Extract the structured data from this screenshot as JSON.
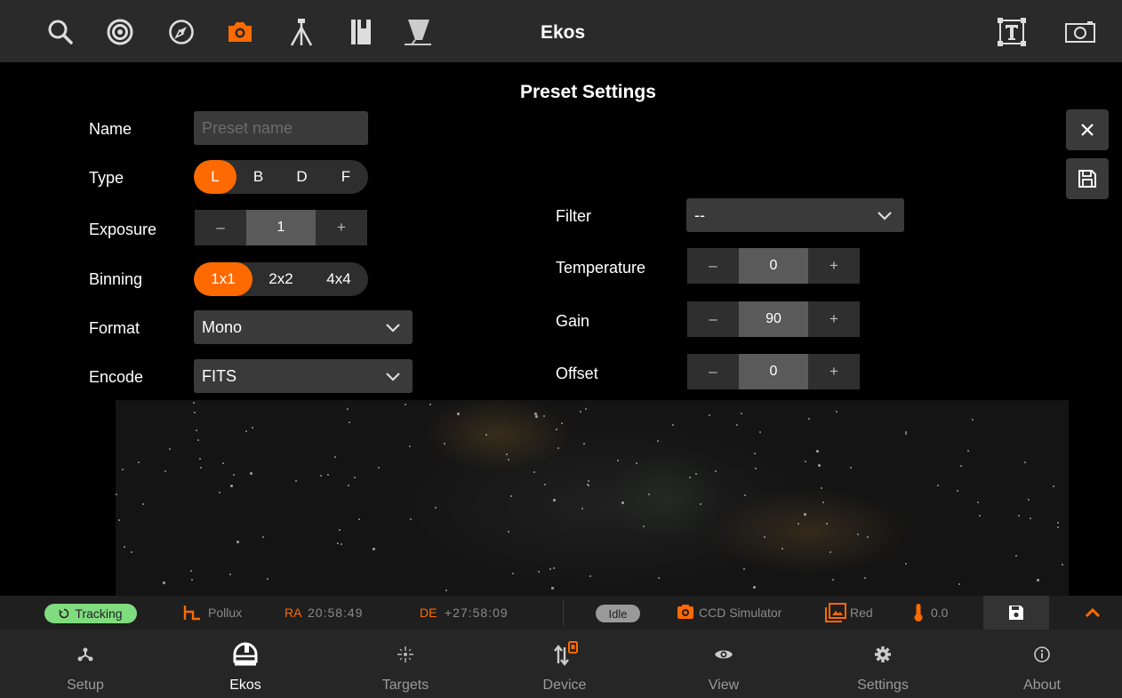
{
  "app": {
    "title": "Ekos"
  },
  "colors": {
    "accent": "#ff6a00",
    "tracking": "#7fdc7f",
    "ra_de_label": "#ff6a00"
  },
  "toolbar": {
    "icons": [
      "search-icon",
      "target-icon",
      "compass-icon",
      "camera-icon",
      "tripod-icon",
      "book-icon",
      "telescope-icon"
    ],
    "active_icon": "camera-icon",
    "right_icons": [
      "text-frame-icon",
      "screen-frame-icon"
    ]
  },
  "preset": {
    "title": "Preset Settings",
    "name": {
      "label": "Name",
      "placeholder": "Preset name",
      "value": ""
    },
    "type": {
      "label": "Type",
      "options": [
        "L",
        "B",
        "D",
        "F"
      ],
      "selected": "L"
    },
    "exposure": {
      "label": "Exposure",
      "value": "1",
      "minus": "–",
      "plus": "+"
    },
    "binning": {
      "label": "Binning",
      "options": [
        "1x1",
        "2x2",
        "4x4"
      ],
      "selected": "1x1"
    },
    "format": {
      "label": "Format",
      "value": "Mono"
    },
    "encode": {
      "label": "Encode",
      "value": "FITS"
    },
    "filter": {
      "label": "Filter",
      "value": "--"
    },
    "temperature": {
      "label": "Temperature",
      "value": "0",
      "minus": "–",
      "plus": "+"
    },
    "gain": {
      "label": "Gain",
      "value": "90",
      "minus": "–",
      "plus": "+"
    },
    "offset": {
      "label": "Offset",
      "value": "0",
      "minus": "–",
      "plus": "+"
    },
    "close_icon": "close-icon",
    "save_icon": "save-icon"
  },
  "status": {
    "tracking": "Tracking",
    "target": "Pollux",
    "ra_label": "RA",
    "ra_value": "20:58:49",
    "de_label": "DE",
    "de_value": "+27:58:09",
    "state": "Idle",
    "camera": "CCD Simulator",
    "filter": "Red",
    "temperature": "0.0"
  },
  "nav": {
    "items": [
      {
        "label": "Setup",
        "icon": "setup-icon"
      },
      {
        "label": "Ekos",
        "icon": "dome-icon"
      },
      {
        "label": "Targets",
        "icon": "targets-icon"
      },
      {
        "label": "Device",
        "icon": "device-icon"
      },
      {
        "label": "View",
        "icon": "eye-icon"
      },
      {
        "label": "Settings",
        "icon": "gear-icon"
      },
      {
        "label": "About",
        "icon": "info-icon"
      }
    ],
    "active": "Ekos"
  }
}
